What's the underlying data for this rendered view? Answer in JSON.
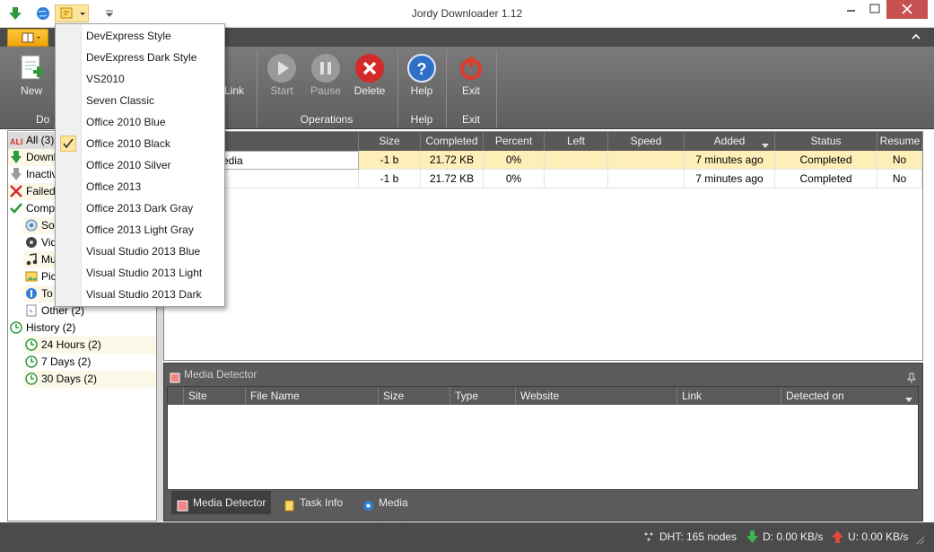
{
  "window": {
    "title": "Jordy Downloader 1.12"
  },
  "ribbon": {
    "buttons": {
      "new": "New",
      "link": "Link",
      "start": "Start",
      "pause": "Pause",
      "delete": "Delete",
      "help": "Help",
      "exit": "Exit"
    },
    "groups": {
      "download": "Do",
      "operations": "Operations",
      "help": "Help",
      "exit": "Exit"
    }
  },
  "sidebar": {
    "items": [
      {
        "label": "All (3)",
        "icon": "all-icon"
      },
      {
        "label": "Downl",
        "icon": "download-arrow-icon"
      },
      {
        "label": "Inactiv",
        "icon": "inactive-arrow-icon"
      },
      {
        "label": "Failed",
        "icon": "failed-x-icon"
      },
      {
        "label": "Compl",
        "icon": "checkmark-icon"
      },
      {
        "label": "So",
        "icon": "software-icon"
      },
      {
        "label": "Vid",
        "icon": "video-icon"
      },
      {
        "label": "Mu",
        "icon": "music-icon"
      },
      {
        "label": "Pic",
        "icon": "picture-icon"
      },
      {
        "label": "To",
        "icon": "torrent-icon"
      },
      {
        "label": "Other (2)",
        "icon": "other-file-icon"
      },
      {
        "label": "History (2)",
        "icon": "history-icon"
      },
      {
        "label": "24 Hours (2)",
        "icon": "history-icon"
      },
      {
        "label": "7 Days (2)",
        "icon": "history-icon"
      },
      {
        "label": "30 Days (2)",
        "icon": "history-icon"
      }
    ]
  },
  "downloads": {
    "columns": [
      "Size",
      "Completed",
      "Percent",
      "Left",
      "Speed",
      "Added",
      "Status",
      "Resume"
    ],
    "rows": [
      {
        "name": "edia",
        "size": "-1 b",
        "completed": "21.72 KB",
        "percent": "0%",
        "left": "",
        "speed": "",
        "added": "7 minutes ago",
        "status": "Completed",
        "resume": "No"
      },
      {
        "name": "",
        "size": "-1 b",
        "completed": "21.72 KB",
        "percent": "0%",
        "left": "",
        "speed": "",
        "added": "7 minutes ago",
        "status": "Completed",
        "resume": "No"
      }
    ]
  },
  "media_detector": {
    "title": "Media Detector",
    "columns": [
      "Site",
      "File Name",
      "Size",
      "Type",
      "Website",
      "Link",
      "Detected on"
    ],
    "tabs": [
      "Media Detector",
      "Task Info",
      "Media Preview"
    ]
  },
  "status": {
    "dht": "DHT: 165 nodes",
    "download": "D: 0.00 KB/s",
    "upload": "U: 0.00 KB/s"
  },
  "style_menu": {
    "items": [
      "DevExpress Style",
      "DevExpress Dark Style",
      "VS2010",
      "Seven Classic",
      "Office 2010 Blue",
      "Office 2010 Black",
      "Office 2010 Silver",
      "Office 2013",
      "Office 2013 Dark Gray",
      "Office 2013 Light Gray",
      "Visual Studio 2013 Blue",
      "Visual Studio 2013 Light",
      "Visual Studio 2013 Dark"
    ],
    "checked": "Office 2010 Black"
  },
  "colors": {
    "accent": "#f0a30a",
    "selection": "#fdefb7",
    "ribbon": "#6b6b6b",
    "statusbar": "#4b4b4b"
  }
}
